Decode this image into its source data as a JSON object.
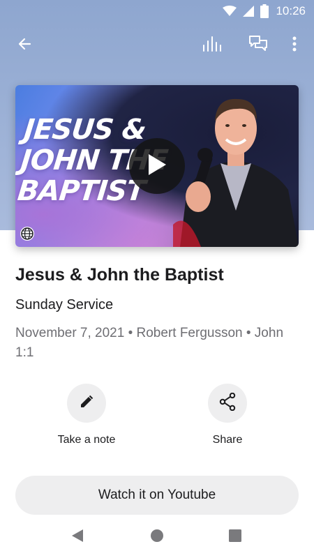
{
  "status_bar": {
    "time": "10:26",
    "icons": [
      "wifi-icon",
      "signal-icon",
      "battery-icon"
    ]
  },
  "app_bar": {
    "icons": [
      "arrow-back-icon",
      "audio-bars-icon",
      "chat-icon",
      "more-vert-icon"
    ]
  },
  "media": {
    "thumbnail_title": "JESUS &\nJOHN THE\nBAPTIST",
    "play_icon": "play-icon",
    "globe_icon": "globe-icon"
  },
  "sermon": {
    "title": "Jesus & John the Baptist",
    "subtitle": "Sunday Service",
    "meta": "November 7, 2021 • Robert Fergusson • John 1:1"
  },
  "actions": {
    "note_label": "Take a note",
    "note_icon": "pencil-icon",
    "share_label": "Share",
    "share_icon": "share-icon"
  },
  "youtube_button": {
    "label": "Watch it on Youtube"
  },
  "nav_bar": {
    "icons": [
      "nav-back-icon",
      "nav-home-icon",
      "nav-recents-icon"
    ]
  },
  "colors": {
    "header_bg": "#9fb3d9",
    "button_bg": "#eeeeef",
    "text_primary": "#1c1c1e",
    "text_secondary": "#6e6e73"
  }
}
